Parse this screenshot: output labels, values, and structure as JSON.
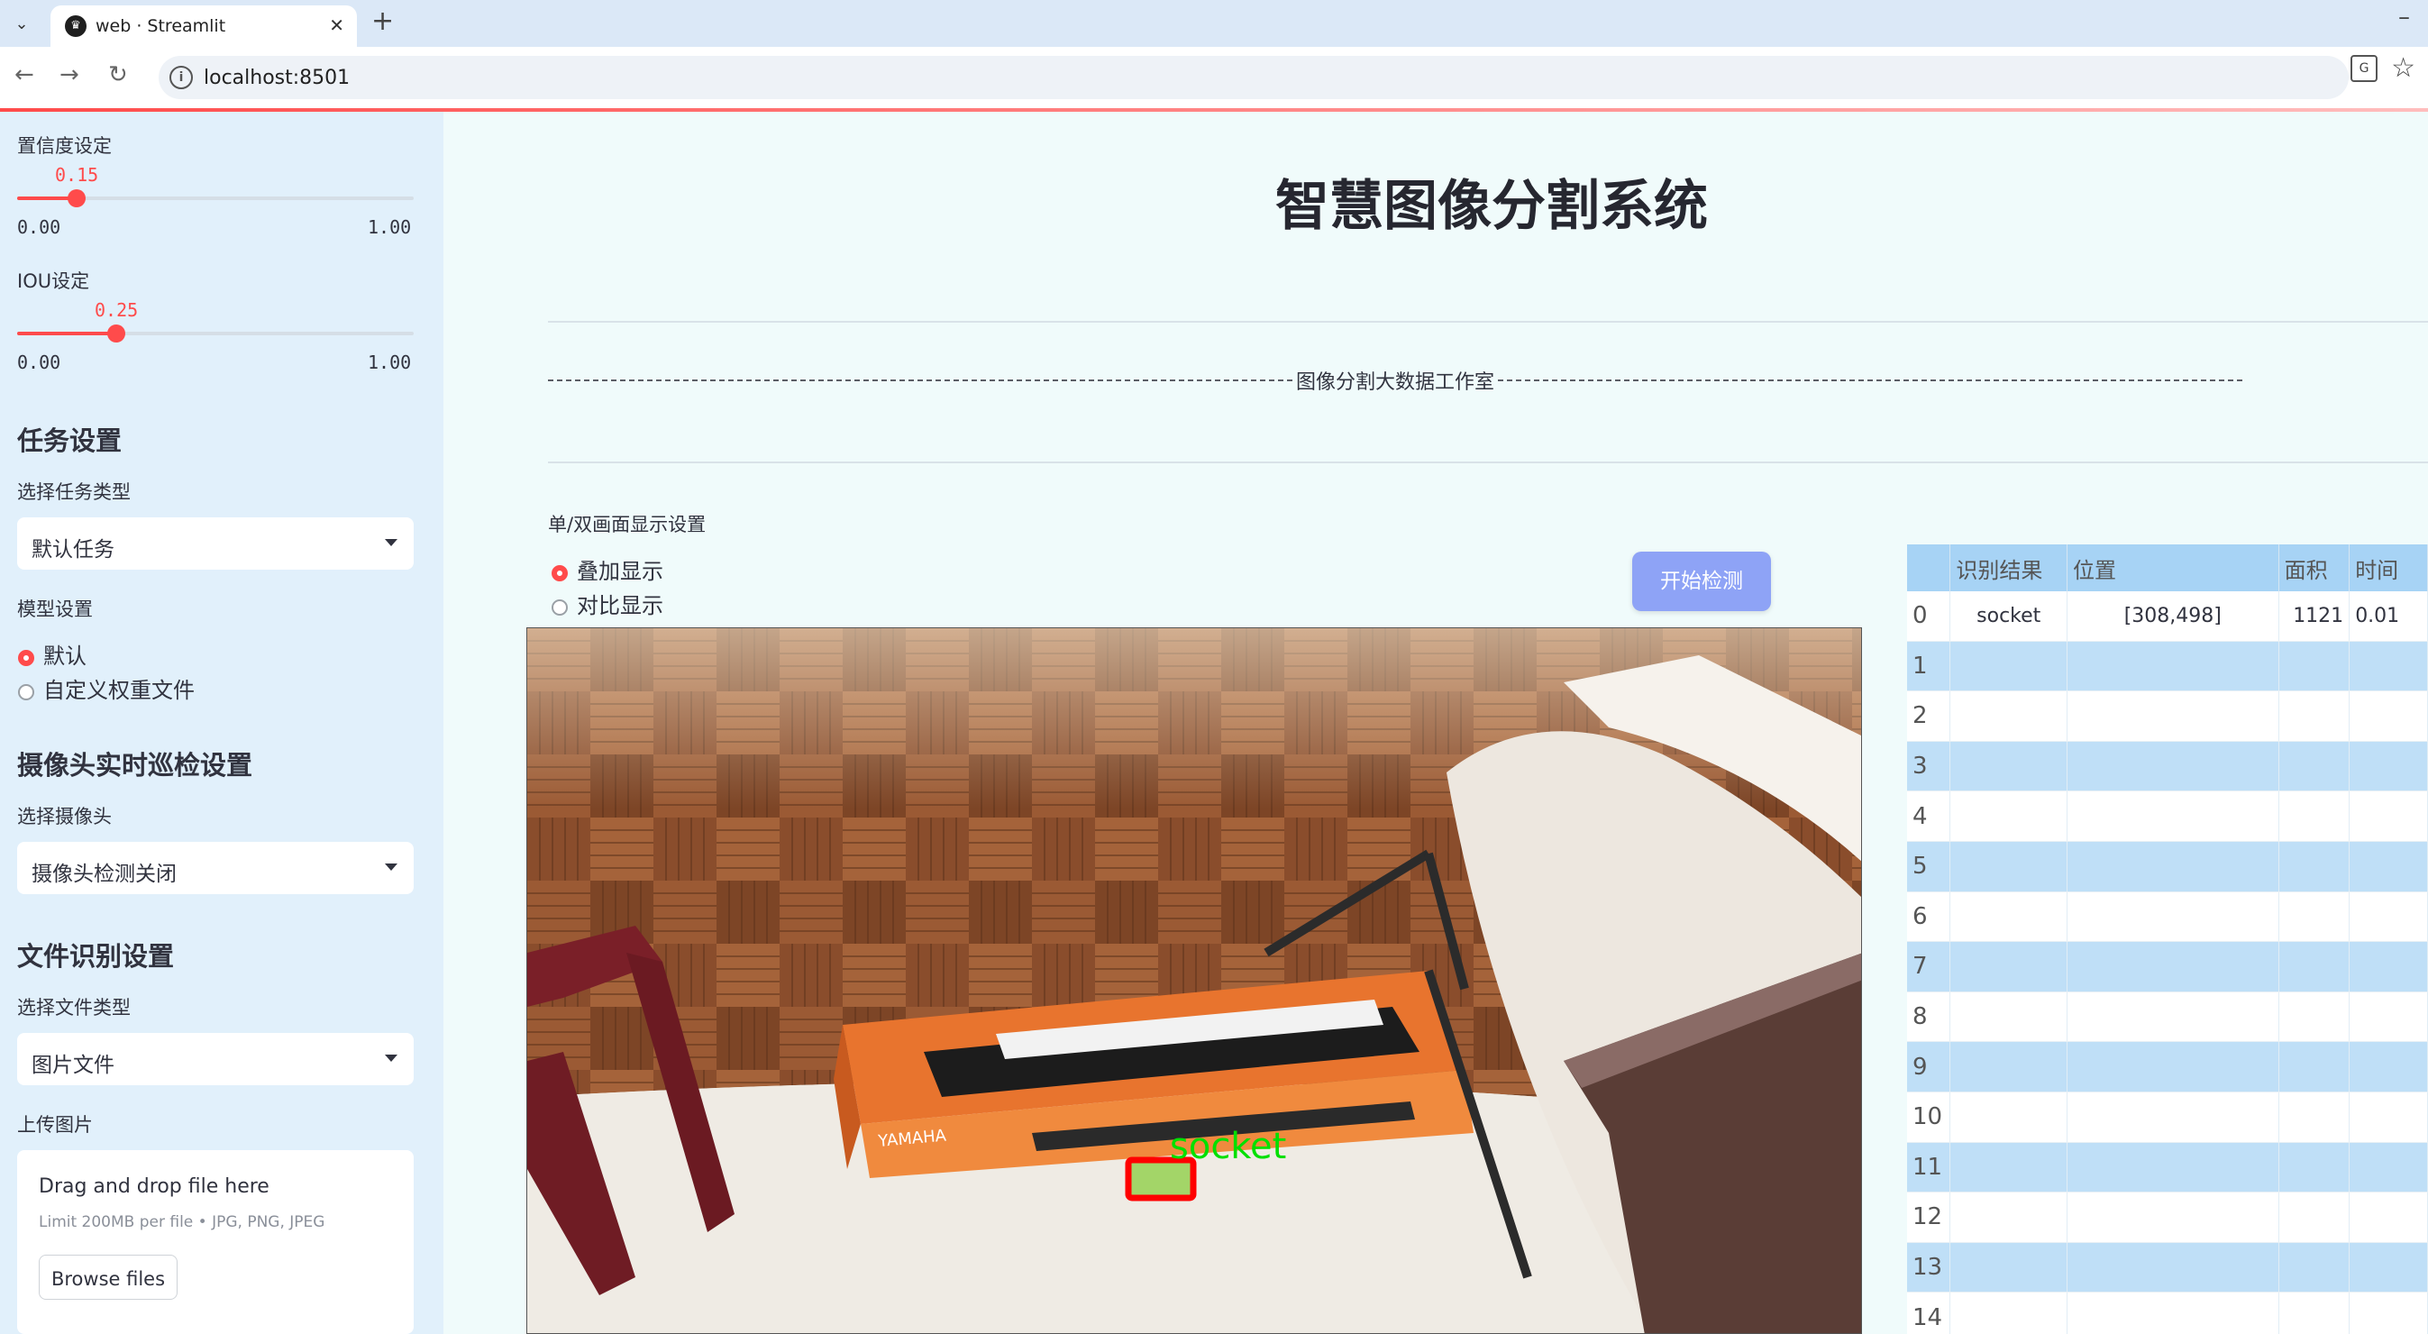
{
  "browser": {
    "tab_title": "web · Streamlit",
    "url": "localhost:8501"
  },
  "sidebar": {
    "confidence": {
      "label": "置信度设定",
      "value": 0.15,
      "value_text": "0.15",
      "min": "0.00",
      "max": "1.00"
    },
    "iou": {
      "label": "IOU设定",
      "value": 0.25,
      "value_text": "0.25",
      "min": "0.00",
      "max": "1.00"
    },
    "task_heading": "任务设置",
    "task_type_label": "选择任务类型",
    "task_type_value": "默认任务",
    "model_label": "模型设置",
    "model_options": [
      "默认",
      "自定义权重文件"
    ],
    "camera_heading": "摄像头实时巡检设置",
    "camera_label": "选择摄像头",
    "camera_value": "摄像头检测关闭",
    "file_heading": "文件识别设置",
    "file_type_label": "选择文件类型",
    "file_type_value": "图片文件",
    "upload_label": "上传图片",
    "upload_title": "Drag and drop file here",
    "upload_limit": "Limit 200MB per file • JPG, PNG, JPEG",
    "browse_label": "Browse files"
  },
  "main": {
    "title": "智慧图像分割系统",
    "studio": "图像分割大数据工作室",
    "display_label": "单/双画面显示设置",
    "display_options": [
      "叠加显示",
      "对比显示"
    ],
    "start_button": "开始检测",
    "detection_label": "socket"
  },
  "table": {
    "columns": [
      "",
      "识别结果",
      "位置",
      "面积",
      "时间"
    ],
    "rows": [
      [
        "0",
        "socket",
        "[308,498]",
        "1121",
        "0.01"
      ],
      [
        "1",
        "",
        "",
        "",
        ""
      ],
      [
        "2",
        "",
        "",
        "",
        ""
      ],
      [
        "3",
        "",
        "",
        "",
        ""
      ],
      [
        "4",
        "",
        "",
        "",
        ""
      ],
      [
        "5",
        "",
        "",
        "",
        ""
      ],
      [
        "6",
        "",
        "",
        "",
        ""
      ],
      [
        "7",
        "",
        "",
        "",
        ""
      ],
      [
        "8",
        "",
        "",
        "",
        ""
      ],
      [
        "9",
        "",
        "",
        "",
        ""
      ],
      [
        "10",
        "",
        "",
        "",
        ""
      ],
      [
        "11",
        "",
        "",
        "",
        ""
      ],
      [
        "12",
        "",
        "",
        "",
        ""
      ],
      [
        "13",
        "",
        "",
        "",
        ""
      ],
      [
        "14",
        "",
        "",
        "",
        ""
      ]
    ]
  },
  "colors": {
    "accent": "#ff4b4b",
    "button": "#8ea3f6",
    "sidebar_bg": "#e1f0fb",
    "table_header": "#a7d3f5",
    "detection_box": "#ff0000",
    "detection_text": "#00e000"
  }
}
